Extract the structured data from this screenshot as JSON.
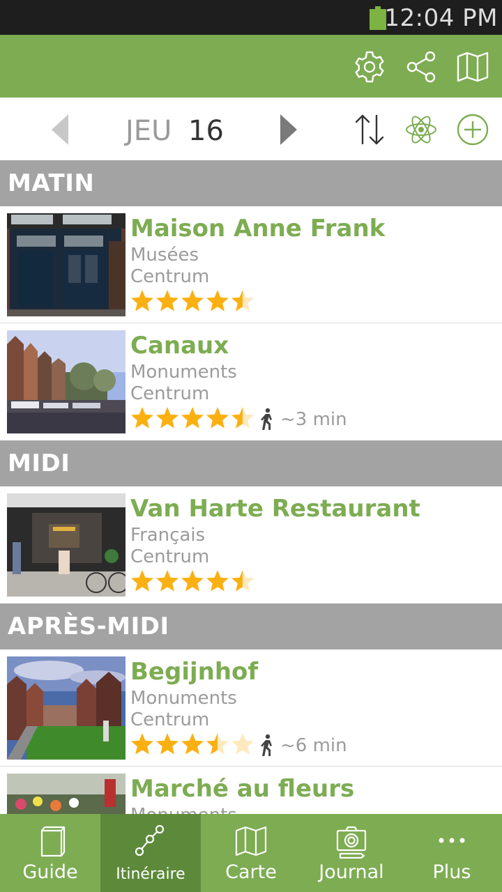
{
  "status_bar": {
    "time": "12:04 PM",
    "battery_color": "#7cb342"
  },
  "action_bar": {
    "color": "#7dac52",
    "icons": [
      "gear-icon",
      "share-icon",
      "map-icon"
    ]
  },
  "date_nav": {
    "day_of_week": "JEU",
    "day_number": "16",
    "icons": [
      "chevron-left-icon",
      "chevron-right-icon",
      "sort-icon",
      "atom-icon",
      "add-circle-icon"
    ]
  },
  "sections": [
    {
      "title": "MATIN",
      "items": [
        {
          "name": "Maison Anne Frank",
          "category": "Musées",
          "area": "Centrum",
          "rating": 4.5,
          "walk_time": ""
        },
        {
          "name": "Canaux",
          "category": "Monuments",
          "area": "Centrum",
          "rating": 4.5,
          "walk_time": "~3 min"
        }
      ]
    },
    {
      "title": "MIDI",
      "items": [
        {
          "name": "Van Harte Restaurant",
          "category": "Français",
          "area": "Centrum",
          "rating": 4.5,
          "walk_time": ""
        }
      ]
    },
    {
      "title": "APRÈS-MIDI",
      "items": [
        {
          "name": "Begijnhof",
          "category": "Monuments",
          "area": "Centrum",
          "rating": 3.5,
          "walk_time": "~6 min"
        },
        {
          "name": "Marché au fleurs",
          "category": "Monuments",
          "area": "",
          "rating": 0,
          "walk_time": ""
        }
      ]
    }
  ],
  "bottom_nav": {
    "tabs": [
      {
        "label": "Guide",
        "icon": "book-icon"
      },
      {
        "label": "Itinéraire",
        "icon": "route-icon",
        "active": true
      },
      {
        "label": "Carte",
        "icon": "map-icon"
      },
      {
        "label": "Journal",
        "icon": "camera-icon"
      },
      {
        "label": "Plus",
        "icon": "more-icon"
      }
    ]
  },
  "colors": {
    "accent": "#7dac52",
    "active_tab": "#5d8a3a",
    "section_header": "#a3a3a3",
    "star": "#fbb012"
  }
}
